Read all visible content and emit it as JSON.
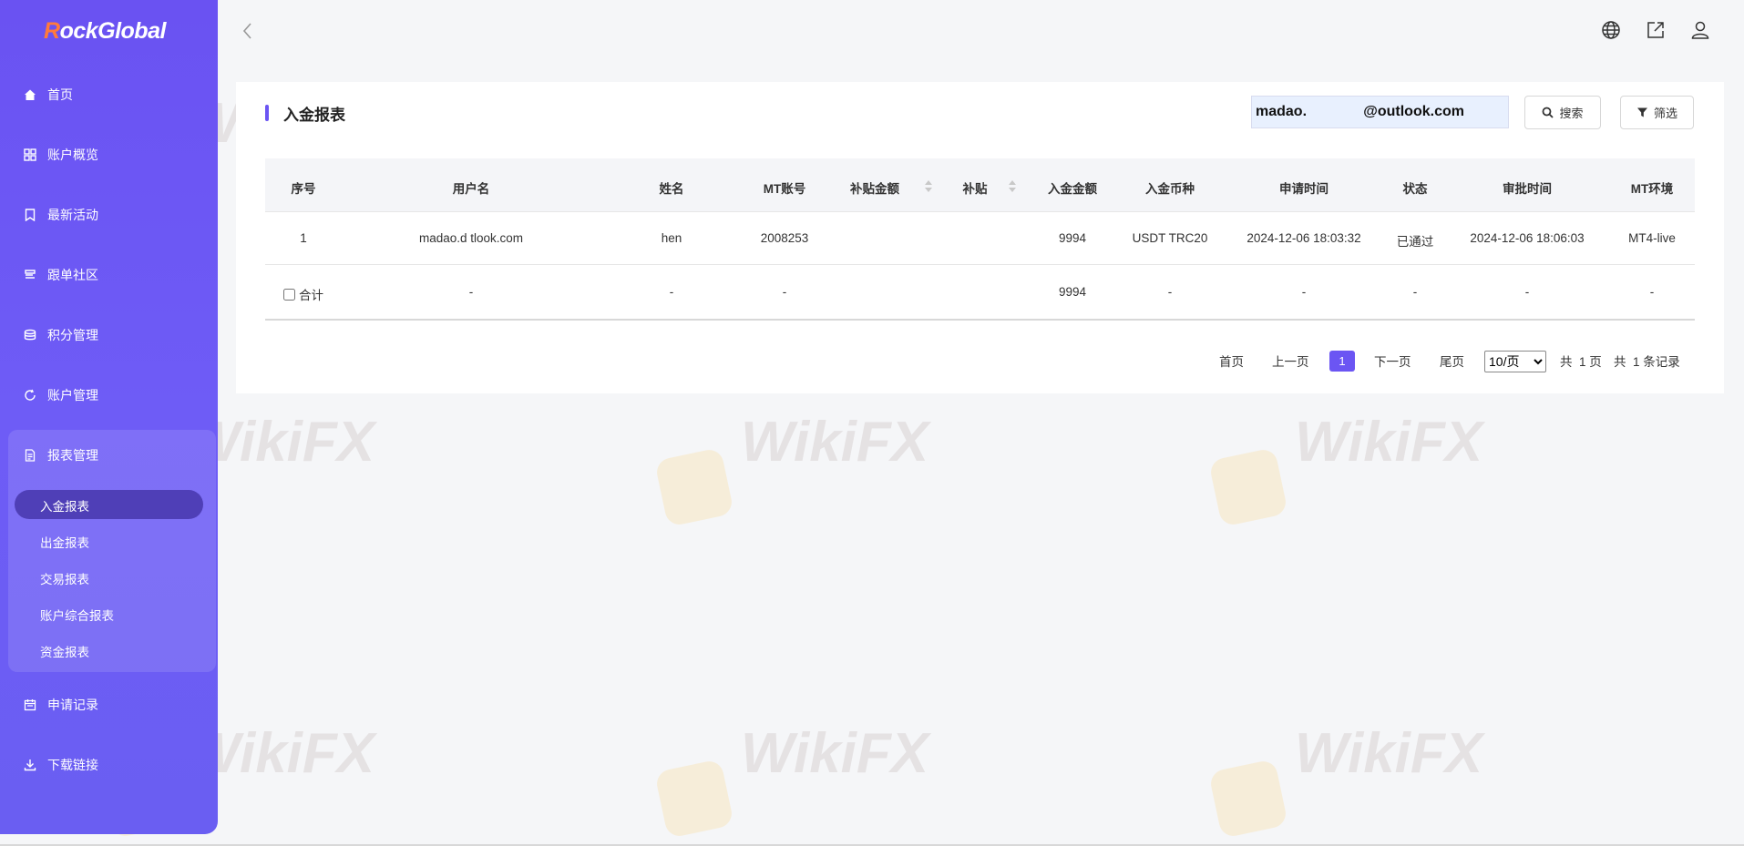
{
  "brand": {
    "logo_r": "R",
    "logo_text": "ockGlobal"
  },
  "sidebar": {
    "items": [
      {
        "label": "首页",
        "icon": "home-icon"
      },
      {
        "label": "账户概览",
        "icon": "grid-icon"
      },
      {
        "label": "最新活动",
        "icon": "bookmark-icon"
      },
      {
        "label": "跟单社区",
        "icon": "community-icon"
      },
      {
        "label": "积分管理",
        "icon": "coins-icon"
      },
      {
        "label": "账户管理",
        "icon": "refresh-icon"
      },
      {
        "label": "报表管理",
        "icon": "document-icon"
      },
      {
        "label": "申请记录",
        "icon": "calendar-icon"
      },
      {
        "label": "下载链接",
        "icon": "download-icon"
      }
    ],
    "report_sub": [
      "入金报表",
      "出金报表",
      "交易报表",
      "账户综合报表",
      "资金报表"
    ]
  },
  "page": {
    "title": "入金报表",
    "search_value": "madao.              @outlook.com",
    "search_label": "搜索",
    "filter_label": "筛选"
  },
  "table": {
    "headers": [
      "序号",
      "用户名",
      "姓名",
      "MT账号",
      "补贴金额",
      "补贴",
      "入金金额",
      "入金币种",
      "申请时间",
      "状态",
      "审批时间",
      "MT环境"
    ],
    "rows": [
      [
        "1",
        "madao.d             tlook.com",
        "            hen",
        "2008253",
        "",
        "",
        "9994",
        "USDT TRC20",
        "2024-12-06 18:03:32",
        "已通过",
        "2024-12-06 18:06:03",
        "MT4-live"
      ]
    ],
    "total": [
      "合计",
      "-",
      "-",
      "-",
      "",
      "",
      "9994",
      "-",
      "-",
      "-",
      "-",
      "-"
    ]
  },
  "pagination": {
    "first": "首页",
    "prev": "上一页",
    "current": "1",
    "next": "下一页",
    "last": "尾页",
    "page_size": "10/页",
    "total_pages_prefix": "共",
    "total_pages": "1",
    "total_pages_suffix": "页",
    "total_records_prefix": "共",
    "total_records": "1",
    "total_records_suffix": "条记录"
  },
  "topbar": {
    "icons": [
      "globe-icon",
      "share-icon",
      "user-icon"
    ]
  },
  "watermark": {
    "text": "WikiFX"
  },
  "colors": {
    "accent": "#6b55f3",
    "sidebar": "#6a52f2",
    "brand_r": "#ff7a3c"
  }
}
